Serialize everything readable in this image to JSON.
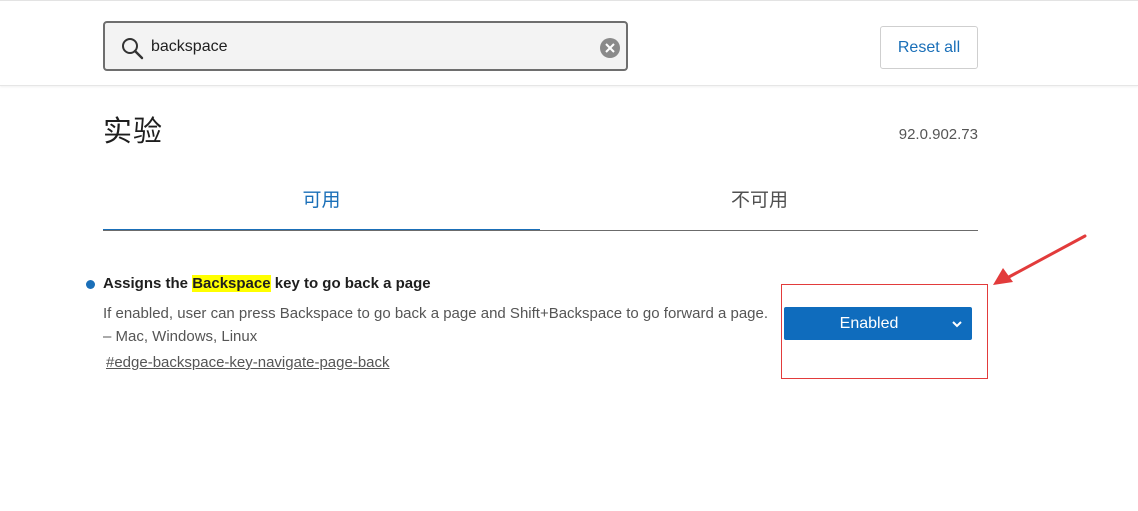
{
  "search": {
    "value": "backspace",
    "icon": "search-icon",
    "clear_icon": "clear-icon"
  },
  "header": {
    "reset_label": "Reset all"
  },
  "page": {
    "title": "实验",
    "version": "92.0.902.73"
  },
  "tabs": [
    {
      "label": "可用",
      "active": true
    },
    {
      "label": "不可用",
      "active": false
    }
  ],
  "flag": {
    "name_prefix": "Assigns the ",
    "name_highlight": "Backspace",
    "name_suffix": " key to go back a page",
    "description": "If enabled, user can press Backspace to go back a page and Shift+Backspace to go forward a page. – Mac, Windows, Linux",
    "link": "#edge-backspace-key-navigate-page-back",
    "select_value": "Enabled"
  },
  "colors": {
    "accent": "#0f6cbd",
    "highlight": "#ffff00",
    "annotation": "#e23b3b"
  }
}
